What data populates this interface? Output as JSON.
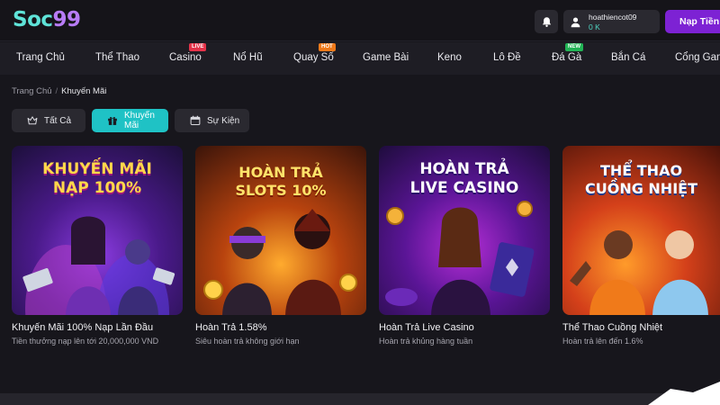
{
  "header": {
    "logo_part1": "Soc",
    "logo_part2": "99",
    "username": "hoathiencot09",
    "balance": "0 K",
    "deposit_label": "Nạp Tiền"
  },
  "nav": {
    "items": [
      {
        "label": "Trang Chủ"
      },
      {
        "label": "Thể Thao"
      },
      {
        "label": "Casino",
        "badge": "LIVE"
      },
      {
        "label": "Nổ Hũ"
      },
      {
        "label": "Quay Số",
        "badge": "HOT"
      },
      {
        "label": "Game Bài"
      },
      {
        "label": "Keno"
      },
      {
        "label": "Lô Đề"
      },
      {
        "label": "Đá Gà",
        "badge": "NEW"
      },
      {
        "label": "Bắn Cá"
      },
      {
        "label": "Cổng Game"
      }
    ]
  },
  "breadcrumb": {
    "home": "Trang Chủ",
    "separator": "/",
    "current": "Khuyến Mãi"
  },
  "tabs": [
    {
      "label": "Tất Cả",
      "icon": "crown-icon"
    },
    {
      "label": "Khuyến Mãi",
      "icon": "gift-icon",
      "active": true
    },
    {
      "label": "Sự Kiện",
      "icon": "calendar-icon"
    }
  ],
  "promos": [
    {
      "banner_line1": "KHUYẾN MÃI",
      "banner_line2": "NẠP 100%",
      "title": "Khuyến Mãi 100% Nạp Lần Đầu",
      "subtitle": "Tiền thưởng nạp lên tới 20,000,000 VND"
    },
    {
      "banner_line1": "HOÀN TRẢ",
      "banner_line2": "SLOTS 10%",
      "title": "Hoàn Trả 1.58%",
      "subtitle": "Siêu hoàn trả không giới hạn"
    },
    {
      "banner_line1": "HOÀN TRẢ",
      "banner_line2": "LIVE CASINO",
      "title": "Hoàn Trả Live Casino",
      "subtitle": "Hoàn trả khủng hàng tuần"
    },
    {
      "banner_line1": "THỂ THAO",
      "banner_line2": "CUỒNG NHIỆT",
      "title": "Thể Thao Cuồng Nhiệt",
      "subtitle": "Hoàn trả lên đến 1.6%"
    }
  ],
  "colors": {
    "background": "#17161c",
    "accent_teal": "#1fc2c5",
    "deposit_purple": "#7d22d4",
    "balance_green": "#4fd5c2"
  }
}
